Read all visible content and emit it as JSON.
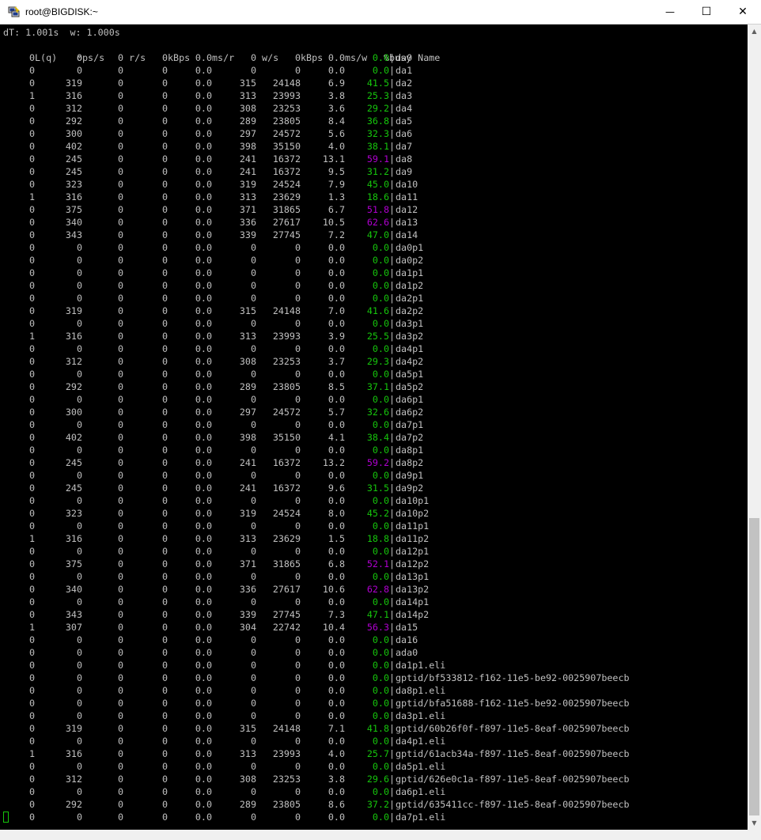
{
  "window": {
    "title": "root@BIGDISK:~",
    "buttons": {
      "minimize": "—",
      "maximize": "☐",
      "close": "✕"
    }
  },
  "header_line": "dT: 1.001s  w: 1.000s",
  "columns": [
    "L(q)",
    "ops/s",
    "r/s",
    "kBps",
    "ms/r",
    "w/s",
    "kBps",
    "ms/w",
    "%busy",
    "Name"
  ],
  "separator": "|",
  "rows": [
    [
      "0",
      "0",
      "0",
      "0",
      "0.0",
      "0",
      "0",
      "0.0",
      "0.0",
      "da0"
    ],
    [
      "0",
      "0",
      "0",
      "0",
      "0.0",
      "0",
      "0",
      "0.0",
      "0.0",
      "da1"
    ],
    [
      "0",
      "319",
      "0",
      "0",
      "0.0",
      "315",
      "24148",
      "6.9",
      "41.5",
      "da2"
    ],
    [
      "1",
      "316",
      "0",
      "0",
      "0.0",
      "313",
      "23993",
      "3.8",
      "25.3",
      "da3"
    ],
    [
      "0",
      "312",
      "0",
      "0",
      "0.0",
      "308",
      "23253",
      "3.6",
      "29.2",
      "da4"
    ],
    [
      "0",
      "292",
      "0",
      "0",
      "0.0",
      "289",
      "23805",
      "8.4",
      "36.8",
      "da5"
    ],
    [
      "0",
      "300",
      "0",
      "0",
      "0.0",
      "297",
      "24572",
      "5.6",
      "32.3",
      "da6"
    ],
    [
      "0",
      "402",
      "0",
      "0",
      "0.0",
      "398",
      "35150",
      "4.0",
      "38.1",
      "da7"
    ],
    [
      "0",
      "245",
      "0",
      "0",
      "0.0",
      "241",
      "16372",
      "13.1",
      "59.1",
      "da8"
    ],
    [
      "0",
      "245",
      "0",
      "0",
      "0.0",
      "241",
      "16372",
      "9.5",
      "31.2",
      "da9"
    ],
    [
      "0",
      "323",
      "0",
      "0",
      "0.0",
      "319",
      "24524",
      "7.9",
      "45.0",
      "da10"
    ],
    [
      "1",
      "316",
      "0",
      "0",
      "0.0",
      "313",
      "23629",
      "1.3",
      "18.6",
      "da11"
    ],
    [
      "0",
      "375",
      "0",
      "0",
      "0.0",
      "371",
      "31865",
      "6.7",
      "51.8",
      "da12"
    ],
    [
      "0",
      "340",
      "0",
      "0",
      "0.0",
      "336",
      "27617",
      "10.5",
      "62.6",
      "da13"
    ],
    [
      "0",
      "343",
      "0",
      "0",
      "0.0",
      "339",
      "27745",
      "7.2",
      "47.0",
      "da14"
    ],
    [
      "0",
      "0",
      "0",
      "0",
      "0.0",
      "0",
      "0",
      "0.0",
      "0.0",
      "da0p1"
    ],
    [
      "0",
      "0",
      "0",
      "0",
      "0.0",
      "0",
      "0",
      "0.0",
      "0.0",
      "da0p2"
    ],
    [
      "0",
      "0",
      "0",
      "0",
      "0.0",
      "0",
      "0",
      "0.0",
      "0.0",
      "da1p1"
    ],
    [
      "0",
      "0",
      "0",
      "0",
      "0.0",
      "0",
      "0",
      "0.0",
      "0.0",
      "da1p2"
    ],
    [
      "0",
      "0",
      "0",
      "0",
      "0.0",
      "0",
      "0",
      "0.0",
      "0.0",
      "da2p1"
    ],
    [
      "0",
      "319",
      "0",
      "0",
      "0.0",
      "315",
      "24148",
      "7.0",
      "41.6",
      "da2p2"
    ],
    [
      "0",
      "0",
      "0",
      "0",
      "0.0",
      "0",
      "0",
      "0.0",
      "0.0",
      "da3p1"
    ],
    [
      "1",
      "316",
      "0",
      "0",
      "0.0",
      "313",
      "23993",
      "3.9",
      "25.5",
      "da3p2"
    ],
    [
      "0",
      "0",
      "0",
      "0",
      "0.0",
      "0",
      "0",
      "0.0",
      "0.0",
      "da4p1"
    ],
    [
      "0",
      "312",
      "0",
      "0",
      "0.0",
      "308",
      "23253",
      "3.7",
      "29.3",
      "da4p2"
    ],
    [
      "0",
      "0",
      "0",
      "0",
      "0.0",
      "0",
      "0",
      "0.0",
      "0.0",
      "da5p1"
    ],
    [
      "0",
      "292",
      "0",
      "0",
      "0.0",
      "289",
      "23805",
      "8.5",
      "37.1",
      "da5p2"
    ],
    [
      "0",
      "0",
      "0",
      "0",
      "0.0",
      "0",
      "0",
      "0.0",
      "0.0",
      "da6p1"
    ],
    [
      "0",
      "300",
      "0",
      "0",
      "0.0",
      "297",
      "24572",
      "5.7",
      "32.6",
      "da6p2"
    ],
    [
      "0",
      "0",
      "0",
      "0",
      "0.0",
      "0",
      "0",
      "0.0",
      "0.0",
      "da7p1"
    ],
    [
      "0",
      "402",
      "0",
      "0",
      "0.0",
      "398",
      "35150",
      "4.1",
      "38.4",
      "da7p2"
    ],
    [
      "0",
      "0",
      "0",
      "0",
      "0.0",
      "0",
      "0",
      "0.0",
      "0.0",
      "da8p1"
    ],
    [
      "0",
      "245",
      "0",
      "0",
      "0.0",
      "241",
      "16372",
      "13.2",
      "59.2",
      "da8p2"
    ],
    [
      "0",
      "0",
      "0",
      "0",
      "0.0",
      "0",
      "0",
      "0.0",
      "0.0",
      "da9p1"
    ],
    [
      "0",
      "245",
      "0",
      "0",
      "0.0",
      "241",
      "16372",
      "9.6",
      "31.5",
      "da9p2"
    ],
    [
      "0",
      "0",
      "0",
      "0",
      "0.0",
      "0",
      "0",
      "0.0",
      "0.0",
      "da10p1"
    ],
    [
      "0",
      "323",
      "0",
      "0",
      "0.0",
      "319",
      "24524",
      "8.0",
      "45.2",
      "da10p2"
    ],
    [
      "0",
      "0",
      "0",
      "0",
      "0.0",
      "0",
      "0",
      "0.0",
      "0.0",
      "da11p1"
    ],
    [
      "1",
      "316",
      "0",
      "0",
      "0.0",
      "313",
      "23629",
      "1.5",
      "18.8",
      "da11p2"
    ],
    [
      "0",
      "0",
      "0",
      "0",
      "0.0",
      "0",
      "0",
      "0.0",
      "0.0",
      "da12p1"
    ],
    [
      "0",
      "375",
      "0",
      "0",
      "0.0",
      "371",
      "31865",
      "6.8",
      "52.1",
      "da12p2"
    ],
    [
      "0",
      "0",
      "0",
      "0",
      "0.0",
      "0",
      "0",
      "0.0",
      "0.0",
      "da13p1"
    ],
    [
      "0",
      "340",
      "0",
      "0",
      "0.0",
      "336",
      "27617",
      "10.6",
      "62.8",
      "da13p2"
    ],
    [
      "0",
      "0",
      "0",
      "0",
      "0.0",
      "0",
      "0",
      "0.0",
      "0.0",
      "da14p1"
    ],
    [
      "0",
      "343",
      "0",
      "0",
      "0.0",
      "339",
      "27745",
      "7.3",
      "47.1",
      "da14p2"
    ],
    [
      "1",
      "307",
      "0",
      "0",
      "0.0",
      "304",
      "22742",
      "10.4",
      "56.3",
      "da15"
    ],
    [
      "0",
      "0",
      "0",
      "0",
      "0.0",
      "0",
      "0",
      "0.0",
      "0.0",
      "da16"
    ],
    [
      "0",
      "0",
      "0",
      "0",
      "0.0",
      "0",
      "0",
      "0.0",
      "0.0",
      "ada0"
    ],
    [
      "0",
      "0",
      "0",
      "0",
      "0.0",
      "0",
      "0",
      "0.0",
      "0.0",
      "da1p1.eli"
    ],
    [
      "0",
      "0",
      "0",
      "0",
      "0.0",
      "0",
      "0",
      "0.0",
      "0.0",
      "gptid/bf533812-f162-11e5-be92-0025907beecb"
    ],
    [
      "0",
      "0",
      "0",
      "0",
      "0.0",
      "0",
      "0",
      "0.0",
      "0.0",
      "da8p1.eli"
    ],
    [
      "0",
      "0",
      "0",
      "0",
      "0.0",
      "0",
      "0",
      "0.0",
      "0.0",
      "gptid/bfa51688-f162-11e5-be92-0025907beecb"
    ],
    [
      "0",
      "0",
      "0",
      "0",
      "0.0",
      "0",
      "0",
      "0.0",
      "0.0",
      "da3p1.eli"
    ],
    [
      "0",
      "319",
      "0",
      "0",
      "0.0",
      "315",
      "24148",
      "7.1",
      "41.8",
      "gptid/60b26f0f-f897-11e5-8eaf-0025907beecb"
    ],
    [
      "0",
      "0",
      "0",
      "0",
      "0.0",
      "0",
      "0",
      "0.0",
      "0.0",
      "da4p1.eli"
    ],
    [
      "1",
      "316",
      "0",
      "0",
      "0.0",
      "313",
      "23993",
      "4.0",
      "25.7",
      "gptid/61acb34a-f897-11e5-8eaf-0025907beecb"
    ],
    [
      "0",
      "0",
      "0",
      "0",
      "0.0",
      "0",
      "0",
      "0.0",
      "0.0",
      "da5p1.eli"
    ],
    [
      "0",
      "312",
      "0",
      "0",
      "0.0",
      "308",
      "23253",
      "3.8",
      "29.6",
      "gptid/626e0c1a-f897-11e5-8eaf-0025907beecb"
    ],
    [
      "0",
      "0",
      "0",
      "0",
      "0.0",
      "0",
      "0",
      "0.0",
      "0.0",
      "da6p1.eli"
    ],
    [
      "0",
      "292",
      "0",
      "0",
      "0.0",
      "289",
      "23805",
      "8.6",
      "37.2",
      "gptid/635411cc-f897-11e5-8eaf-0025907beecb"
    ],
    [
      "0",
      "0",
      "0",
      "0",
      "0.0",
      "0",
      "0",
      "0.0",
      "0.0",
      "da7p1.eli"
    ]
  ],
  "colors": {
    "busy_low": "#16c60c",
    "busy_high": "#b000d0",
    "text": "#c0c0c0",
    "background": "#000000"
  },
  "busy_high_threshold": 50,
  "icons": {
    "app": "putty-icon"
  }
}
